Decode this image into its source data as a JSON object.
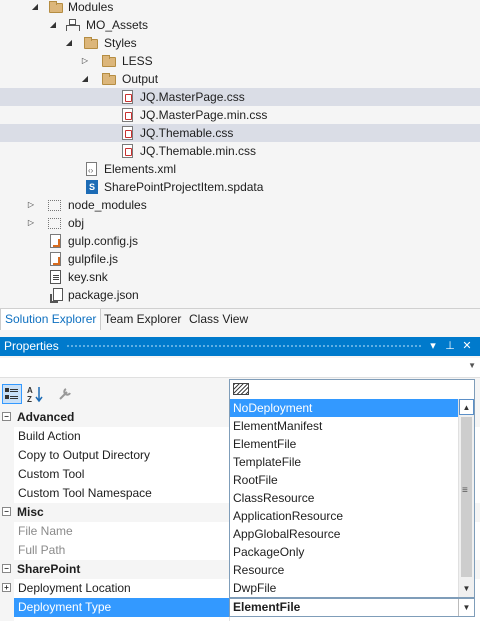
{
  "tree": {
    "items": [
      {
        "label": "Modules",
        "icon": "folder-icon",
        "expander": "expanded"
      },
      {
        "label": "MO_Assets",
        "icon": "module-assets-icon",
        "expander": "expanded"
      },
      {
        "label": "Styles",
        "icon": "folder-icon",
        "expander": "expanded"
      },
      {
        "label": "LESS",
        "icon": "folder-icon",
        "expander": "collapsed"
      },
      {
        "label": "Output",
        "icon": "folder-icon",
        "expander": "expanded"
      },
      {
        "label": "JQ.MasterPage.css",
        "icon": "css-file-icon",
        "highlight": true
      },
      {
        "label": "JQ.MasterPage.min.css",
        "icon": "css-file-icon"
      },
      {
        "label": "JQ.Themable.css",
        "icon": "css-file-icon",
        "highlight": true
      },
      {
        "label": "JQ.Themable.min.css",
        "icon": "css-file-icon"
      },
      {
        "label": "Elements.xml",
        "icon": "xml-file-icon"
      },
      {
        "label": "SharePointProjectItem.spdata",
        "icon": "spdata-file-icon"
      },
      {
        "label": "node_modules",
        "icon": "excluded-folder-icon",
        "expander": "collapsed"
      },
      {
        "label": "obj",
        "icon": "excluded-folder-icon",
        "expander": "collapsed"
      },
      {
        "label": "gulp.config.js",
        "icon": "js-file-icon"
      },
      {
        "label": "gulpfile.js",
        "icon": "js-file-icon"
      },
      {
        "label": "key.snk",
        "icon": "key-file-icon"
      },
      {
        "label": "package.json",
        "icon": "json-file-icon"
      }
    ]
  },
  "tabs": {
    "solution_explorer": "Solution Explorer",
    "team_explorer": "Team Explorer",
    "class_view": "Class View"
  },
  "properties_panel": {
    "title": "Properties",
    "controls": {
      "dropdown": "▾",
      "pin": "⊥",
      "close": "✕"
    },
    "toolbar": {
      "categorized_icon": "categorized-icon",
      "alphabetical_icon": "alphabetical-icon",
      "property_pages_icon": "wrench-icon"
    },
    "rows": [
      {
        "type": "category",
        "label": "Advanced",
        "expander": "⊟"
      },
      {
        "type": "property",
        "label": "Build Action"
      },
      {
        "type": "property",
        "label": "Copy to Output Directory"
      },
      {
        "type": "property",
        "label": "Custom Tool"
      },
      {
        "type": "property",
        "label": "Custom Tool Namespace"
      },
      {
        "type": "category",
        "label": "Misc",
        "expander": "⊟"
      },
      {
        "type": "property",
        "label": "File Name",
        "dim": true
      },
      {
        "type": "property",
        "label": "Full Path",
        "dim": true
      },
      {
        "type": "category",
        "label": "SharePoint",
        "expander": "⊟"
      },
      {
        "type": "property",
        "label": "Deployment Location",
        "expander": "+"
      },
      {
        "type": "property",
        "label": "Deployment Type",
        "selected": true,
        "value": "ElementFile"
      }
    ]
  },
  "deployment_type_dropdown": {
    "current_value": "ElementFile",
    "highlighted": "NoDeployment",
    "options": [
      "NoDeployment",
      "ElementManifest",
      "ElementFile",
      "TemplateFile",
      "RootFile",
      "ClassResource",
      "ApplicationResource",
      "AppGlobalResource",
      "PackageOnly",
      "Resource",
      "DwpFile"
    ]
  },
  "colors": {
    "accent": "#007acc",
    "selection": "#3399ff",
    "highlight_row": "#dadde6",
    "active_tab_text": "#0e70c0"
  }
}
